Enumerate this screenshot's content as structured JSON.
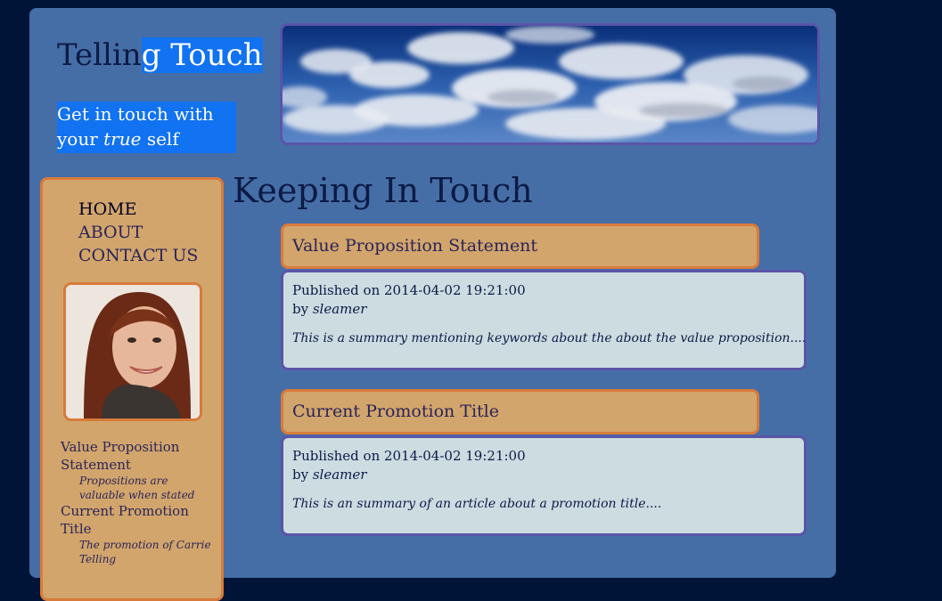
{
  "site": {
    "title_part1": "Tellin",
    "title_part2": "g Touch",
    "tagline_line1": "Get in touch with",
    "tagline_line2_a": "your ",
    "tagline_line2_em": "true",
    "tagline_line2_b": " self"
  },
  "nav": {
    "items": [
      {
        "label": "HOME"
      },
      {
        "label": "ABOUT"
      },
      {
        "label": "CONTACT US"
      }
    ]
  },
  "recent": [
    {
      "title": "Value Proposition Statement",
      "desc": "Propositions are valuable when stated"
    },
    {
      "title": "Current Promotion Title",
      "desc": "The promotion of Carrie Telling"
    }
  ],
  "main": {
    "heading": "Keeping In Touch",
    "posts": [
      {
        "title": "Value Proposition Statement",
        "published": "Published on 2014-04-02 19:21:00",
        "by_prefix": "by ",
        "author": "sleamer",
        "summary": "This is a summary mentioning keywords about the about the value proposition...."
      },
      {
        "title": "Current Promotion Title",
        "published": "Published on 2014-04-02 19:21:00",
        "by_prefix": "by ",
        "author": "sleamer",
        "summary": "This is an summary of an article about a promotion title...."
      }
    ]
  },
  "colors": {
    "background": "#001438",
    "page": "#466ea6",
    "accent_blue": "#1172f2",
    "sidebar": "#d2a56c",
    "border_orange": "#d97a3a",
    "border_purple": "#5a54a8",
    "post_box": "#cddce1"
  },
  "icons": {
    "banner": "cloudy-sky-image",
    "avatar": "profile-photo"
  }
}
